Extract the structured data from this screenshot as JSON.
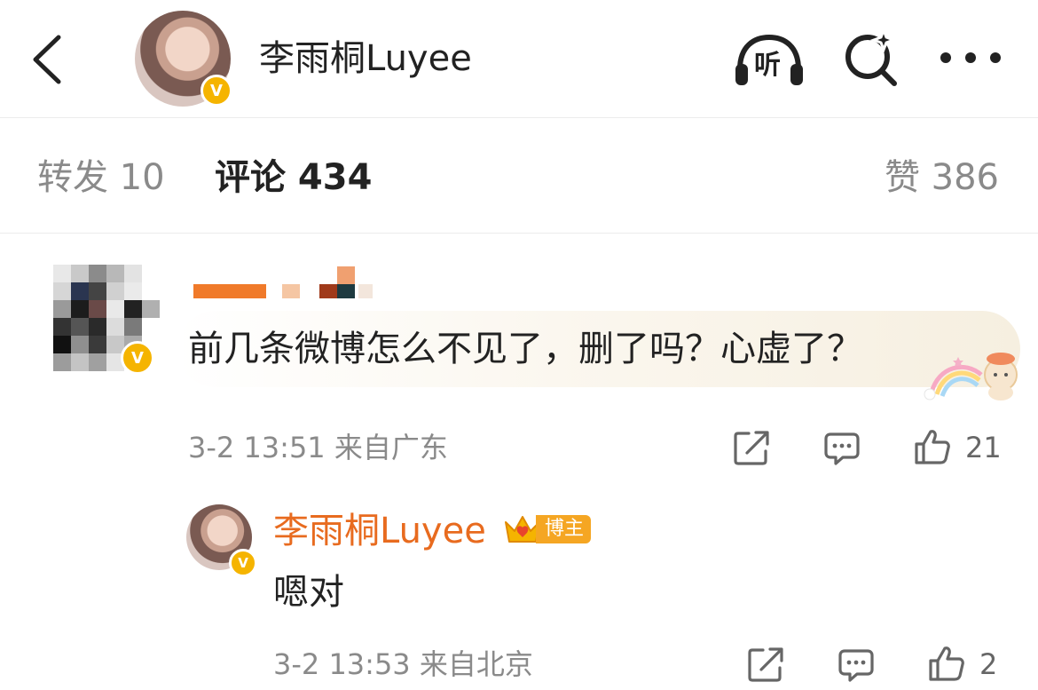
{
  "header": {
    "title": "李雨桐Luyee",
    "verified_mark": "V",
    "icons": [
      "back-chevron-icon",
      "listen-headphones-icon",
      "search-sparkle-icon",
      "more-dots-icon"
    ],
    "listen_label": "听"
  },
  "tabs": {
    "repost": "转发 10",
    "comment": "评论 434",
    "like": "赞 386"
  },
  "comments": [
    {
      "text": "前几条微博怎么不见了，删了吗？心虚了？",
      "meta": "3-2 13:51 来自广东",
      "likes": "21",
      "verified_mark": "V",
      "reply": {
        "author": "李雨桐Luyee",
        "badge": "博主",
        "text": "嗯对",
        "meta": "3-2 13:53 来自北京",
        "likes": "2",
        "verified_mark": "V"
      }
    }
  ],
  "colors": {
    "accent_orange": "#e86b1f",
    "verified_gold": "#f5b400",
    "badge_orange": "#f5a623",
    "muted_text": "#8a8a8a"
  }
}
